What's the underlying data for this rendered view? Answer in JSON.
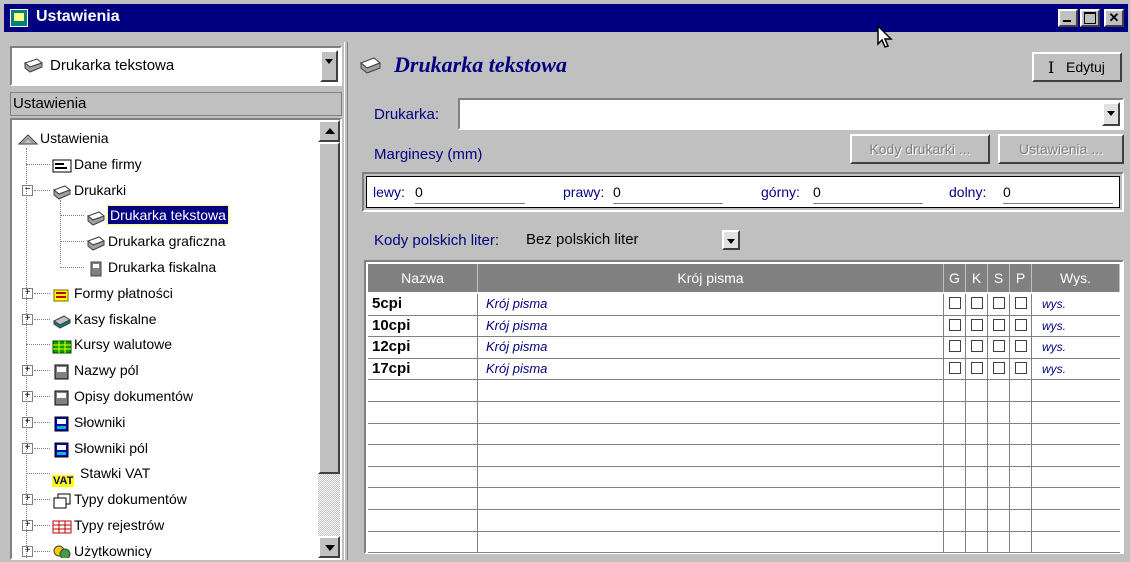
{
  "window": {
    "title": "Ustawienia"
  },
  "left": {
    "combo_value": "Drukarka tekstowa",
    "panel_header": "Ustawienia",
    "tree": [
      {
        "label": "Ustawienia",
        "icon": "hat-icon"
      },
      {
        "label": "Dane firmy",
        "icon": "card-icon"
      },
      {
        "label": "Drukarki",
        "icon": "printer-icon",
        "expander": "−"
      },
      {
        "label": "Drukarka tekstowa",
        "icon": "printer-icon",
        "selected": true
      },
      {
        "label": "Drukarka graficzna",
        "icon": "printer-icon"
      },
      {
        "label": "Drukarka fiskalna",
        "icon": "fiscal-printer-icon"
      },
      {
        "label": "Formy płatności",
        "icon": "payment-icon",
        "expander": "+"
      },
      {
        "label": "Kasy fiskalne",
        "icon": "cash-register-icon",
        "expander": "+"
      },
      {
        "label": "Kursy walutowe",
        "icon": "grid-green-icon"
      },
      {
        "label": "Nazwy pól",
        "icon": "form-icon",
        "expander": "+"
      },
      {
        "label": "Opisy dokumentów",
        "icon": "form-icon",
        "expander": "+"
      },
      {
        "label": "Słowniki",
        "icon": "dictionary-icon",
        "expander": "+"
      },
      {
        "label": "Słowniki pól",
        "icon": "dictionary-icon",
        "expander": "+"
      },
      {
        "label": "Stawki VAT",
        "icon": "vat-icon",
        "icon_text": "VAT"
      },
      {
        "label": "Typy dokumentów",
        "icon": "documents-icon",
        "expander": "+"
      },
      {
        "label": "Typy rejestrów",
        "icon": "grid-red-icon",
        "expander": "+"
      },
      {
        "label": "Użytkownicy",
        "icon": "users-icon",
        "expander": "+"
      }
    ]
  },
  "right": {
    "header_title": "Drukarka tekstowa",
    "edit_label": "Edytuj",
    "printer_label": "Drukarka:",
    "printer_value": "",
    "margins_label": "Marginesy (mm)",
    "codes_button": "Kody drukarki ...",
    "settings_button": "Ustawienia ...",
    "margins": {
      "left_label": "lewy:",
      "left": "0",
      "right_label": "prawy:",
      "right": "0",
      "top_label": "górny:",
      "top": "0",
      "bottom_label": "dolny:",
      "bottom": "0"
    },
    "polish_codes_label": "Kody polskich liter:",
    "polish_codes_value": "Bez polskich liter",
    "grid": {
      "headers": {
        "name": "Nazwa",
        "font": "Krój pisma",
        "g": "G",
        "k": "K",
        "s": "S",
        "p": "P",
        "height": "Wys."
      },
      "rows": [
        {
          "name": "5cpi",
          "font": "Krój pisma",
          "height": "wys."
        },
        {
          "name": "10cpi",
          "font": "Krój pisma",
          "height": "wys."
        },
        {
          "name": "12cpi",
          "font": "Krój pisma",
          "height": "wys."
        },
        {
          "name": "17cpi",
          "font": "Krój pisma",
          "height": "wys."
        }
      ]
    }
  }
}
